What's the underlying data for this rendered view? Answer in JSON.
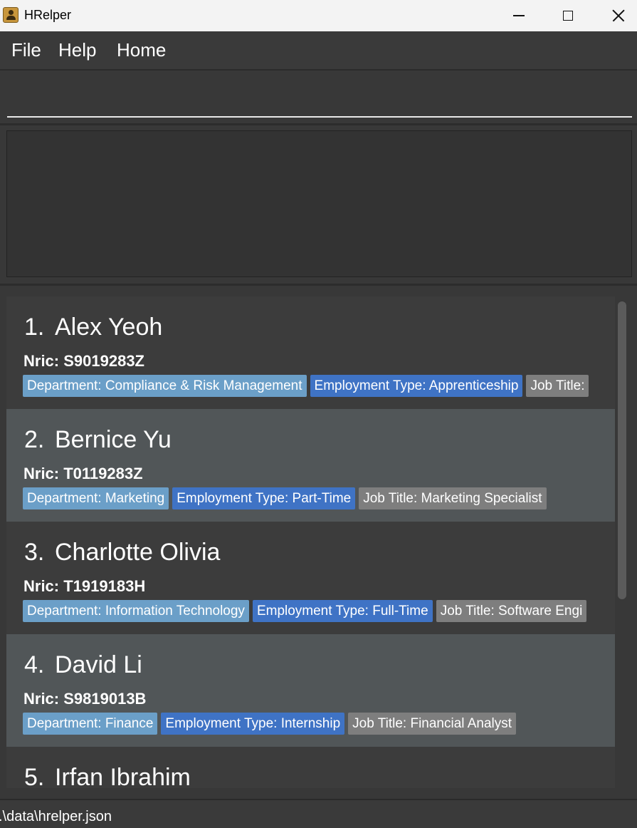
{
  "window": {
    "title": "HRelper",
    "app_icon": "address-book-icon"
  },
  "menu": {
    "items": [
      "File",
      "Help",
      "Home"
    ]
  },
  "command_box": {
    "value": "",
    "placeholder": ""
  },
  "result_display": {
    "text": ""
  },
  "persons": [
    {
      "index": "1.",
      "name": "Alex Yeoh",
      "nric": "Nric: S9019283Z",
      "tags": [
        {
          "kind": "dept",
          "text": "Department: Compliance & Risk Management"
        },
        {
          "kind": "emp",
          "text": "Employment Type: Apprenticeship"
        },
        {
          "kind": "job",
          "text": "Job Title: "
        }
      ]
    },
    {
      "index": "2.",
      "name": "Bernice Yu",
      "nric": "Nric: T0119283Z",
      "tags": [
        {
          "kind": "dept",
          "text": "Department: Marketing"
        },
        {
          "kind": "emp",
          "text": "Employment Type: Part-Time"
        },
        {
          "kind": "job",
          "text": "Job Title: Marketing Specialist"
        }
      ]
    },
    {
      "index": "3.",
      "name": "Charlotte Olivia",
      "nric": "Nric: T1919183H",
      "tags": [
        {
          "kind": "dept",
          "text": "Department: Information Technology"
        },
        {
          "kind": "emp",
          "text": "Employment Type: Full-Time"
        },
        {
          "kind": "job",
          "text": "Job Title: Software Engi"
        }
      ]
    },
    {
      "index": "4.",
      "name": "David Li",
      "nric": "Nric: S9819013B",
      "tags": [
        {
          "kind": "dept",
          "text": "Department: Finance"
        },
        {
          "kind": "emp",
          "text": "Employment Type: Internship"
        },
        {
          "kind": "job",
          "text": "Job Title: Financial Analyst"
        }
      ]
    },
    {
      "index": "5.",
      "name": "Irfan Ibrahim",
      "nric": "",
      "tags": []
    }
  ],
  "status_bar": {
    "path": ".\\data\\hrelper.json"
  },
  "colors": {
    "tag_department": "#6b9fc8",
    "tag_employment": "#3f73c5",
    "tag_job": "#7e7e7e",
    "card_even": "#515658",
    "card_odd": "#3c3c3c"
  }
}
